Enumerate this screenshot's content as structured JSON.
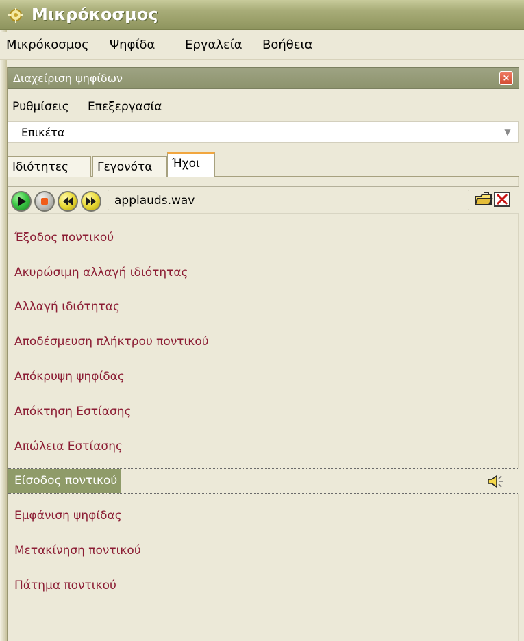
{
  "window": {
    "title": "Μικρόκοσμος",
    "icon": "app-icon"
  },
  "menubar": {
    "items": [
      "Μικρόκοσμος",
      "Ψηφίδα",
      "Εργαλεία",
      "Βοήθεια"
    ]
  },
  "panel": {
    "title": "Διαχείριση ψηφίδων",
    "close_label": "×",
    "submenu": [
      "Ρυθμίσεις",
      "Επεξεργασία"
    ],
    "selector": {
      "value": "Επικέτα",
      "arrow": "▼"
    },
    "tabs": [
      {
        "label": "Ιδιότητες",
        "active": false
      },
      {
        "label": "Γεγονότα",
        "active": false
      },
      {
        "label": "Ήχοι",
        "active": true
      }
    ]
  },
  "player": {
    "file_name": "applauds.wav",
    "controls": [
      "play-icon",
      "stop-icon",
      "rewind-icon",
      "fast-forward-icon"
    ],
    "actions": [
      "open-folder-icon",
      "delete-icon"
    ]
  },
  "events": [
    {
      "label": "Έξοδος ποντικού"
    },
    {
      "label": "Ακυρώσιμη αλλαγή ιδιότητας"
    },
    {
      "label": "Αλλαγή ιδιότητας"
    },
    {
      "label": "Αποδέσμευση πλήκτρου ποντικού"
    },
    {
      "label": "Απόκρυψη ψηφίδας"
    },
    {
      "label": "Απόκτηση Εστίασης"
    },
    {
      "label": "Απώλεια Εστίασης"
    },
    {
      "label": "Είσοδος ποντικού",
      "selected": true,
      "icon": "speaker-icon"
    },
    {
      "label": "Εμφάνιση ψηφίδας"
    },
    {
      "label": "Μετακίνηση ποντικού"
    },
    {
      "label": "Πάτημα ποντικού"
    }
  ],
  "colors": {
    "accent": "#f1a63f",
    "event_text": "#8c1d34",
    "selected_background": "#8f9b69",
    "title_bar": "#9ba06a",
    "panel_header": "#8d936d"
  }
}
